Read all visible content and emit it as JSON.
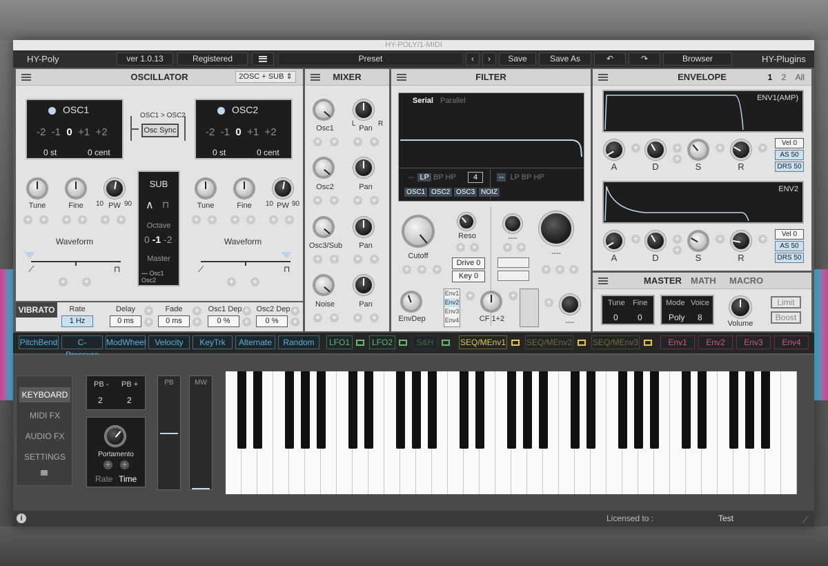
{
  "window": {
    "title": "HY-POLY/1-MIDI"
  },
  "toolbar": {
    "app_name": "HY-Poly",
    "version": "ver 1.0.13",
    "license": "Registered",
    "preset_label": "Preset",
    "save": "Save",
    "save_as": "Save As",
    "browser": "Browser",
    "brand": "HY-Plugins"
  },
  "oscillator": {
    "title": "OSCILLATOR",
    "mode": "2OSC + SUB",
    "osc1": {
      "name": "OSC1",
      "octaves": [
        "-2",
        "-1",
        "0",
        "+1",
        "+2"
      ],
      "semitone": "0 st",
      "cent": "0 cent"
    },
    "osc2": {
      "name": "OSC2",
      "octaves": [
        "-2",
        "-1",
        "0",
        "+1",
        "+2"
      ],
      "semitone": "0 st",
      "cent": "0 cent"
    },
    "sync_label": "OSC1 > OSC2",
    "sync_button": "Osc Sync",
    "tune": "Tune",
    "fine": "Fine",
    "pw": "PW",
    "pw_min": "10",
    "pw_max": "90",
    "waveform": "Waveform",
    "sub": {
      "title": "SUB",
      "octave_label": "Octave",
      "octaves": [
        "0",
        "-1",
        "-2"
      ],
      "master_label": "Master",
      "master_opts": [
        "---",
        "Osc1",
        "Osc2"
      ]
    }
  },
  "vibrato": {
    "title": "VIBRATO",
    "rate_label": "Rate",
    "rate": "1 Hz",
    "delay_label": "Delay",
    "delay": "0 ms",
    "fade_label": "Fade",
    "fade": "0 ms",
    "osc1dep_label": "Osc1 Dep",
    "osc1dep": "0 %",
    "osc2dep_label": "Osc2 Dep",
    "osc2dep": "0 %"
  },
  "mixer": {
    "title": "MIXER",
    "rows": [
      "Osc1",
      "Osc2",
      "Osc3/Sub",
      "Noise"
    ],
    "pan": "Pan",
    "l": "L",
    "r": "R"
  },
  "filter": {
    "title": "FILTER",
    "serial": "Serial",
    "parallel": "Parallel",
    "types": [
      "--",
      "LP",
      "BP",
      "HP"
    ],
    "poles": "4",
    "sources": [
      "OSC1",
      "OSC2",
      "OSC3",
      "NOIZ"
    ],
    "types2": [
      "--",
      "LP",
      "BP",
      "HP"
    ],
    "cutoff": "Cutoff",
    "reso": "Reso",
    "drive_label": "Drive",
    "drive": "0",
    "key_label": "Key",
    "key": "0",
    "dash": "----",
    "envdep": "EnvDep",
    "envs": [
      "Env1",
      "Env2",
      "Env3",
      "Env4"
    ],
    "cf": "CF 1+2"
  },
  "envelope": {
    "title": "ENVELOPE",
    "tabs": [
      "1",
      "2",
      "All"
    ],
    "env1": {
      "name": "ENV1(AMP)",
      "vel": "Vel 0",
      "as": "AS 50",
      "drs": "DRS 50"
    },
    "env2": {
      "name": "ENV2",
      "vel": "Vel 0",
      "as": "AS 50",
      "drs": "DRS 50"
    },
    "a": "A",
    "d": "D",
    "s": "S",
    "r": "R"
  },
  "master": {
    "tabs": [
      "MASTER",
      "MATH",
      "MACRO"
    ],
    "tune_label": "Tune",
    "fine_label": "Fine",
    "tune": "0",
    "fine": "0",
    "mode_label": "Mode",
    "voice_label": "Voice",
    "mode": "Poly",
    "voice": "8",
    "volume": "Volume",
    "limit": "Limit",
    "boost": "Boost"
  },
  "modbar": {
    "sources_blue": [
      "PitchBend",
      "C-Pressure",
      "ModWheel",
      "Velocity",
      "KeyTrk",
      "Alternate",
      "Random"
    ],
    "lfos": [
      "LFO1",
      "LFO2",
      "S&H"
    ],
    "seqs": [
      "SEQ/MEnv1",
      "SEQ/MEnv2",
      "SEQ/MEnv3"
    ],
    "envs": [
      "Env1",
      "Env2",
      "Env3",
      "Env4"
    ],
    "colors": {
      "blue": "#4fb7e3",
      "green": "#5fbf6a",
      "yellow": "#e6c84a",
      "red": "#d8566e"
    }
  },
  "bottom": {
    "nav": [
      "KEYBOARD",
      "MIDI FX",
      "AUDIO FX",
      "SETTINGS"
    ],
    "pb_minus": "PB -",
    "pb_plus": "PB +",
    "pb_minus_val": "2",
    "pb_plus_val": "2",
    "portamento": "Portamento",
    "rate": "Rate",
    "time": "Time",
    "pb": "PB",
    "mw": "MW",
    "licensed_to": "Licensed to :",
    "licensee": "Test"
  }
}
